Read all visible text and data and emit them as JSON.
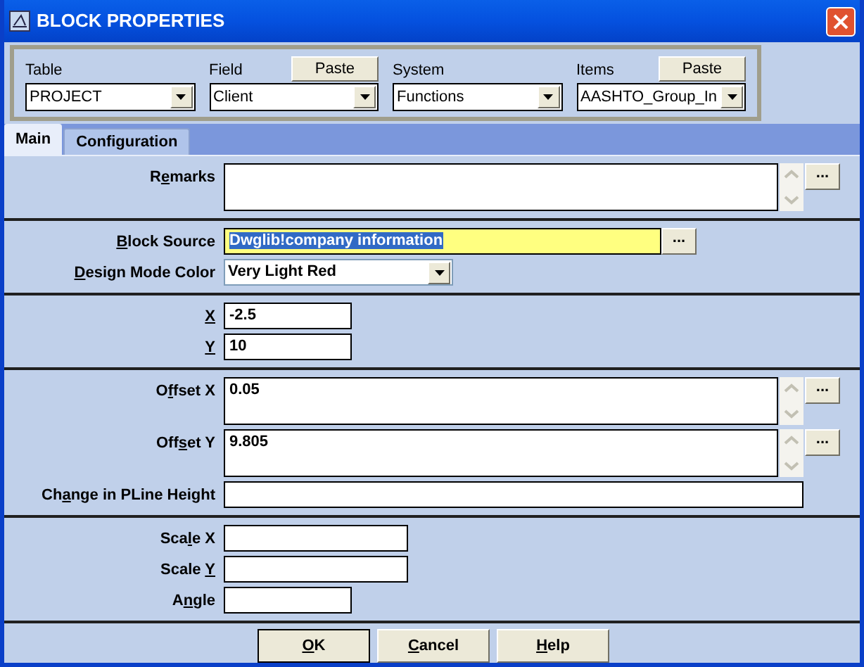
{
  "window": {
    "title": "BLOCK PROPERTIES"
  },
  "source": {
    "groups": [
      {
        "label": "Table",
        "value": "PROJECT"
      },
      {
        "label": "Field",
        "value": "Client",
        "paste": "Paste"
      },
      {
        "label": "System",
        "value": "Functions"
      },
      {
        "label": "Items",
        "value": "AASHTO_Group_In",
        "paste": "Paste"
      }
    ]
  },
  "tabs": [
    {
      "label": "Main",
      "selected": true
    },
    {
      "label": "Configuration",
      "selected": false
    }
  ],
  "sections": [
    {
      "rows": [
        {
          "kind": "memo",
          "label": {
            "pre": "R",
            "key": "e",
            "post": "marks"
          },
          "focused": false,
          "button": "..."
        }
      ]
    },
    {
      "rows": [
        {
          "kind": "browse",
          "label": {
            "key": "B",
            "post": "lock Source"
          },
          "value": "Dwglib!company information",
          "focused": true,
          "button": "..."
        },
        {
          "kind": "dropdown",
          "label": {
            "key": "D",
            "post": "esign Mode Color"
          },
          "value": "Very Light Red",
          "focused": false
        }
      ]
    },
    {
      "rows": [
        {
          "kind": "short",
          "label": {
            "key": "X"
          },
          "value": "-2.5",
          "focused": false
        },
        {
          "kind": "short",
          "label": {
            "key": "Y"
          },
          "value": "10",
          "focused": false
        }
      ]
    },
    {
      "rows": [
        {
          "kind": "memo",
          "label": {
            "pre": "O",
            "key": "f",
            "post": "fset X"
          },
          "value": "0.05",
          "focused": false,
          "button": "..."
        },
        {
          "kind": "memo",
          "label": {
            "pre": "Off",
            "key": "s",
            "post": "et Y"
          },
          "value": "9.805",
          "focused": false,
          "button": "..."
        },
        {
          "kind": "full",
          "label": {
            "pre": "Ch",
            "key": "a",
            "post": "nge in PLine Height"
          },
          "focused": false
        }
      ]
    },
    {
      "rows": [
        {
          "kind": "medium",
          "label": {
            "pre": "Sca",
            "key": "l",
            "post": "e X"
          },
          "focused": false
        },
        {
          "kind": "medium",
          "label": {
            "pre": "Scale ",
            "key": "Y"
          },
          "focused": false
        },
        {
          "kind": "short",
          "label": {
            "pre": "A",
            "key": "n",
            "post": "gle"
          },
          "focused": false
        }
      ]
    }
  ],
  "buttons": [
    {
      "key": "O",
      "post": "K"
    },
    {
      "key": "C",
      "post": "ancel"
    },
    {
      "key": "H",
      "post": "elp"
    }
  ]
}
